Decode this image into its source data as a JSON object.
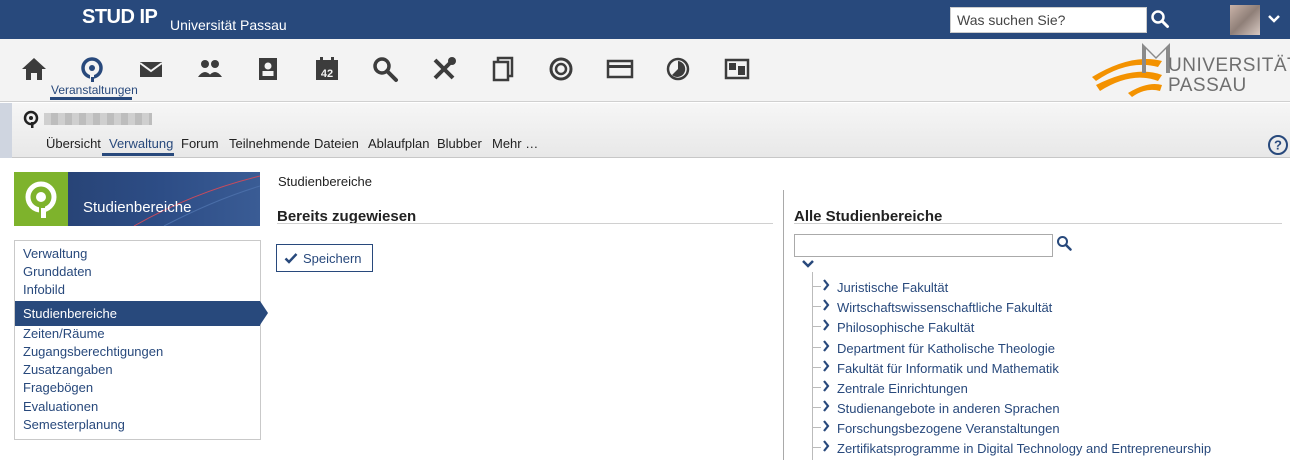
{
  "header": {
    "logo_text": "STUD IP",
    "university": "Universität Passau",
    "search_placeholder": "Was suchen Sie?"
  },
  "mainnav": {
    "active_label": "Veranstaltungen",
    "calendar_day": "42",
    "brand_line1": "UNIVERSITÄT",
    "brand_line2": "PASSAU"
  },
  "course": {
    "tabs": [
      "Übersicht",
      "Verwaltung",
      "Forum",
      "Teilnehmende",
      "Dateien",
      "Ablaufplan",
      "Blubber",
      "Mehr …"
    ],
    "help": "?"
  },
  "sidebar": {
    "title": "Studienbereiche",
    "items": [
      "Verwaltung",
      "Grunddaten",
      "Infobild",
      "Studienbereiche",
      "Zeiten/Räume",
      "Zugangsberechtigungen",
      "Zusatzangaben",
      "Fragebögen",
      "Evaluationen",
      "Semesterplanung"
    ]
  },
  "content": {
    "title": "Studienbereiche",
    "assigned_title": "Bereits zugewiesen",
    "save_label": "Speichern",
    "all_title": "Alle Studienbereiche",
    "tree": [
      "Juristische Fakultät",
      "Wirtschaftswissenschaftliche Fakultät",
      "Philosophische Fakultät",
      "Department für Katholische Theologie",
      "Fakultät für Informatik und Mathematik",
      "Zentrale Einrichtungen",
      "Studienangebote in anderen Sprachen",
      "Forschungsbezogene Veranstaltungen",
      "Zertifikatsprogramme in Digital Technology and Entrepreneurship"
    ]
  },
  "colors": {
    "brand_blue": "#28497c",
    "green": "#7eb32c",
    "orange": "#f39200"
  }
}
